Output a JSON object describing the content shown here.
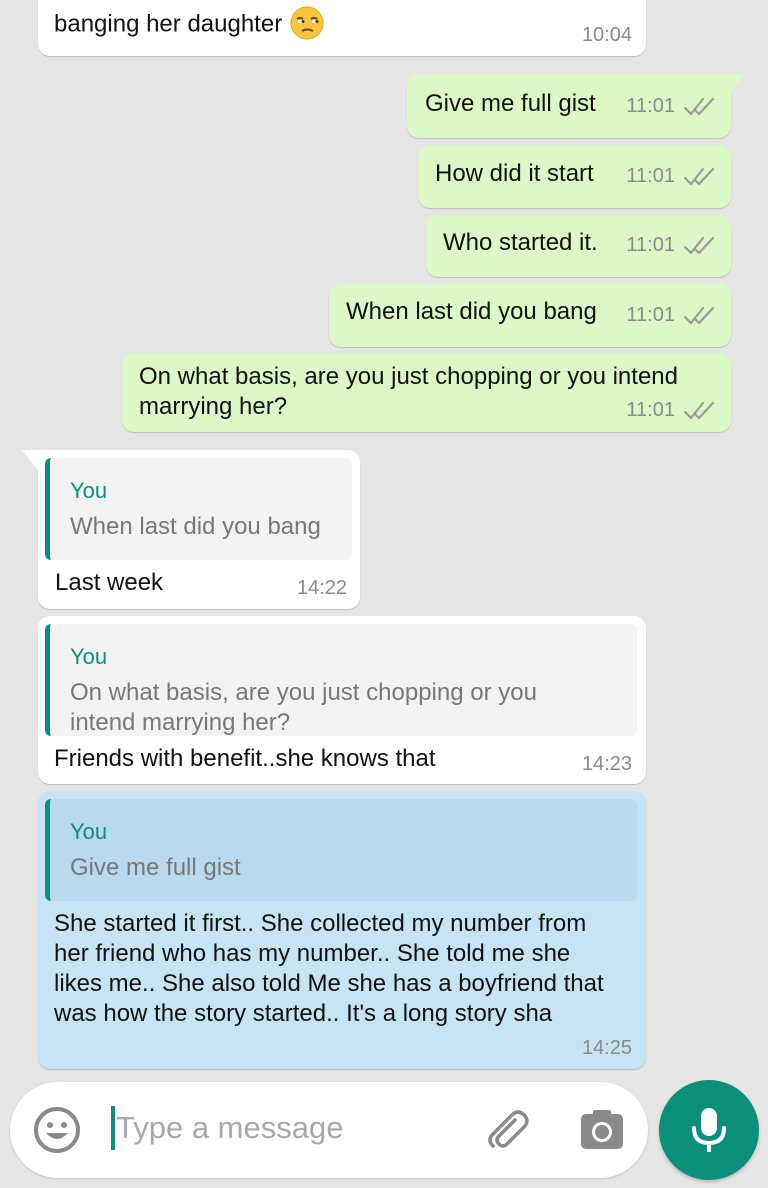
{
  "colors": {
    "background": "#e5e5e5",
    "incoming_bubble": "#ffffff",
    "outgoing_bubble": "#dcf8c6",
    "selected_bubble": "#c7e4f5",
    "accent": "#0b8f7a",
    "timestamp": "#8a8a8a"
  },
  "messages": [
    {
      "direction": "in",
      "text": "banging  her daughter",
      "emoji": "unamused-face-icon",
      "time": "10:04"
    },
    {
      "direction": "out",
      "text": "Give me full gist",
      "time": "11:01",
      "status": "double-check-icon"
    },
    {
      "direction": "out",
      "text": "How did it start",
      "time": "11:01",
      "status": "double-check-icon"
    },
    {
      "direction": "out",
      "text": "Who started it.",
      "time": "11:01",
      "status": "double-check-icon"
    },
    {
      "direction": "out",
      "text": "When last did you bang",
      "time": "11:01",
      "status": "double-check-icon"
    },
    {
      "direction": "out",
      "text": "On what basis, are you just chopping or you intend marrying her?",
      "time": "11:01",
      "status": "double-check-icon"
    },
    {
      "direction": "in",
      "quote": {
        "author": "You",
        "text": "When last did you bang"
      },
      "text": "Last week",
      "time": "14:22"
    },
    {
      "direction": "in",
      "quote": {
        "author": "You",
        "text": "On what basis, are you just chopping or you intend marrying her?"
      },
      "text": "Friends with  benefit..she knows that",
      "time": "14:23"
    },
    {
      "direction": "in",
      "selected": true,
      "quote": {
        "author": "You",
        "text": "Give me full gist"
      },
      "text": "She started it  first.. She collected  my number from  her friend who has  my number.. She told me she likes me.. She also  told Me she has a boyfriend  that was  how the story  started.. It's  a long story sha",
      "time": "14:25"
    }
  ],
  "composer": {
    "placeholder": "Type a message",
    "emoji_icon": "smiley-icon",
    "attach_icon": "paperclip-icon",
    "camera_icon": "camera-icon",
    "mic_icon": "microphone-icon"
  }
}
